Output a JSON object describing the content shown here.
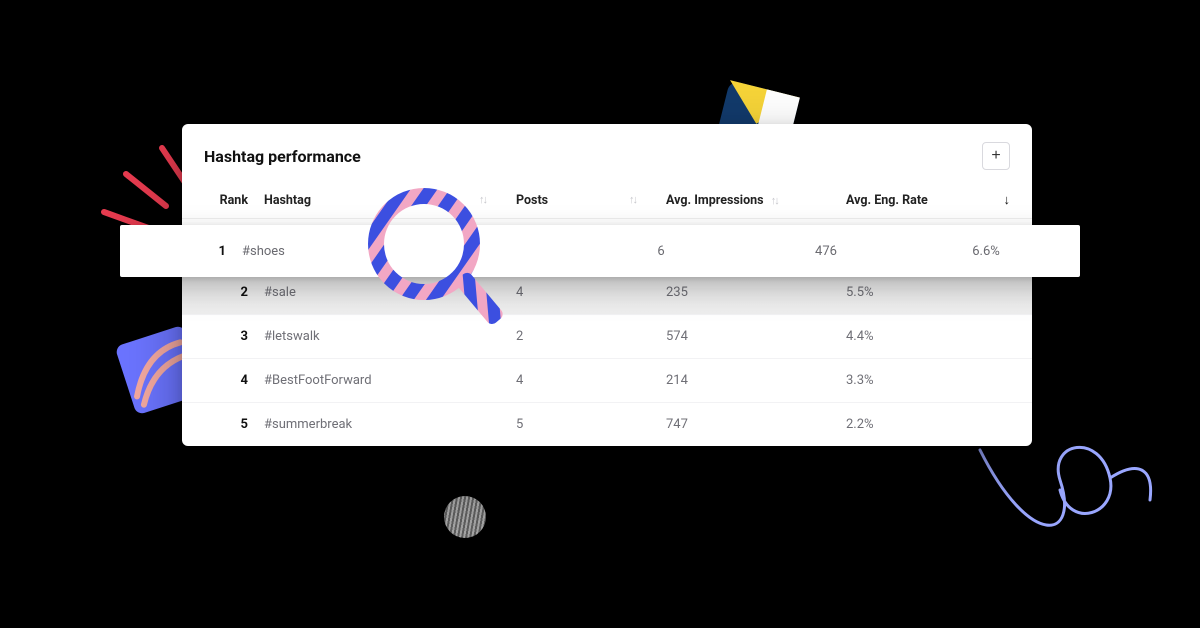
{
  "panel": {
    "title": "Hashtag performance",
    "add_label": "+"
  },
  "columns": {
    "rank": "Rank",
    "hashtag": "Hashtag",
    "posts": "Posts",
    "impressions": "Avg. Impressions",
    "engagement": "Avg. Eng. Rate"
  },
  "rows": [
    {
      "rank": "1",
      "hashtag": "#shoes",
      "posts": "6",
      "impressions": "476",
      "engagement": "6.6%"
    },
    {
      "rank": "2",
      "hashtag": "#sale",
      "posts": "4",
      "impressions": "235",
      "engagement": "5.5%"
    },
    {
      "rank": "3",
      "hashtag": "#letswalk",
      "posts": "2",
      "impressions": "574",
      "engagement": "4.4%"
    },
    {
      "rank": "4",
      "hashtag": "#BestFootForward",
      "posts": "4",
      "impressions": "214",
      "engagement": "3.3%"
    },
    {
      "rank": "5",
      "hashtag": "#summerbreak",
      "posts": "5",
      "impressions": "747",
      "engagement": "2.2%"
    }
  ]
}
